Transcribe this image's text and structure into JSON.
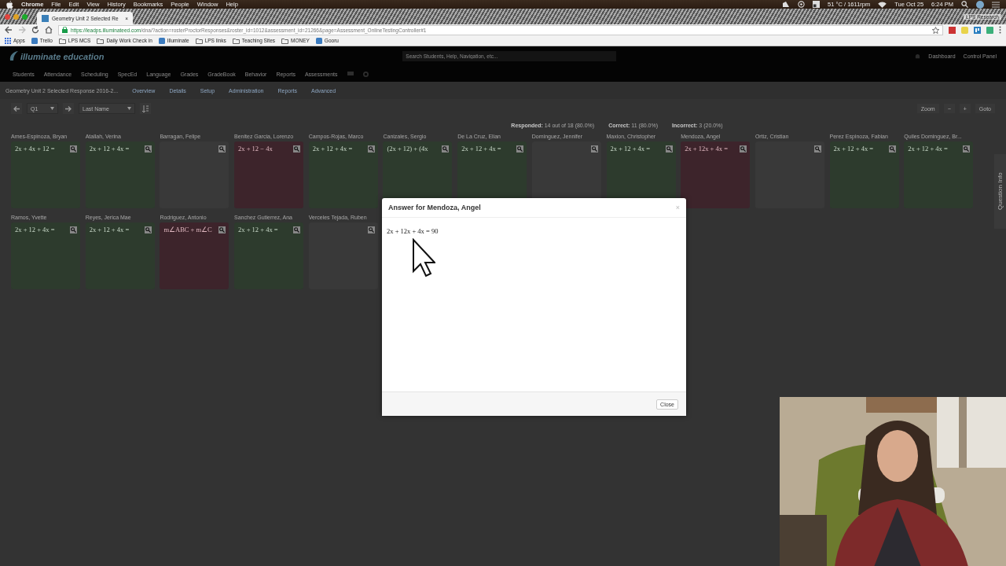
{
  "menubar": {
    "app": "Chrome",
    "menus": [
      "File",
      "Edit",
      "View",
      "History",
      "Bookmarks",
      "People",
      "Window",
      "Help"
    ],
    "sensor": "51 °C / 1611rpm",
    "date": "Tue Oct 25",
    "time": "6:24 PM"
  },
  "browser": {
    "tab_title": "Geometry Unit 2 Selected Re",
    "tab_close": "×",
    "profile": "LPS Research",
    "url_host": "https://leadps.illuminateed.com",
    "url_path": "/dna/?action=rosterProctorResponses&roster_id=1012&assessment_id=21266&page=Assessment_OnlineTestingController#1",
    "bookmarks": [
      {
        "label": "Apps",
        "kind": "apps"
      },
      {
        "label": "Trello",
        "kind": "site"
      },
      {
        "label": "LPS MCS",
        "kind": "folder"
      },
      {
        "label": "Daily Work Check in",
        "kind": "folder"
      },
      {
        "label": "Illuminate",
        "kind": "site"
      },
      {
        "label": "LPS links",
        "kind": "folder"
      },
      {
        "label": "Teaching Sites",
        "kind": "folder"
      },
      {
        "label": "MONEY",
        "kind": "folder"
      },
      {
        "label": "Gooru",
        "kind": "site"
      }
    ]
  },
  "header": {
    "logo": "illuminate education",
    "search": {
      "placeholder": "Search Students, Help, Navigation, etc..."
    },
    "links": [
      "Dashboard",
      "Control Panel"
    ]
  },
  "nav": [
    "Students",
    "Attendance",
    "Scheduling",
    "SpecEd",
    "Language",
    "Grades",
    "GradeBook",
    "Behavior",
    "Reports",
    "Assessments"
  ],
  "subnav": {
    "title": "Geometry Unit 2 Selected Response 2016-2...",
    "links": [
      "Overview",
      "Details",
      "Setup",
      "Administration",
      "Reports",
      "Advanced"
    ]
  },
  "toolbar": {
    "question": "Q1",
    "sort": "Last Name",
    "zoom": "Zoom",
    "zoom_out": "−",
    "zoom_in": "+",
    "goto": "Goto"
  },
  "stats": [
    {
      "label": "Responded:",
      "value": "14 out of 18 (80.0%)"
    },
    {
      "label": "Correct:",
      "value": "11 (80.0%)"
    },
    {
      "label": "Incorrect:",
      "value": "3 (20.0%)"
    }
  ],
  "students": [
    {
      "name": "Ames-Espinoza, Bryan",
      "kind": "correct",
      "answer": "2x + 4x + 12 ="
    },
    {
      "name": "Atallah, Verina",
      "kind": "correct",
      "answer": "2x + 12 + 4x ="
    },
    {
      "name": "Barragan, Felipe",
      "kind": "empty"
    },
    {
      "name": "Benitez Garcia, Lorenzo",
      "kind": "incorrect",
      "answer": "2x + 12 − 4x"
    },
    {
      "name": "Campos-Rojas, Marco",
      "kind": "correct",
      "answer": "2x + 12 + 4x ="
    },
    {
      "name": "Canizales, Sergio",
      "kind": "correct",
      "answer": "(2x + 12) + (4x"
    },
    {
      "name": "De La Cruz, Elian",
      "kind": "correct",
      "answer": "2x + 12 + 4x ="
    },
    {
      "name": "Dominguez, Jennifer",
      "kind": "empty"
    },
    {
      "name": "Maxion, Christopher",
      "kind": "correct",
      "answer": "2x + 12 + 4x ="
    },
    {
      "name": "Mendoza, Angel",
      "kind": "incorrect",
      "answer": "2x + 12x + 4x ="
    },
    {
      "name": "Ortiz, Cristian",
      "kind": "empty"
    },
    {
      "name": "Perez Espinoza, Fabian",
      "kind": "correct",
      "answer": "2x + 12 + 4x ="
    },
    {
      "name": "Quiles Dominguez, Br...",
      "kind": "correct",
      "answer": "2x + 12 + 4x ="
    },
    {
      "name": "Ramos, Yvette",
      "kind": "correct",
      "answer": "2x + 12 + 4x ="
    },
    {
      "name": "Reyes, Jerica Mae",
      "kind": "correct",
      "answer": "2x + 12 + 4x ="
    },
    {
      "name": "Rodriguez, Antonio",
      "kind": "incorrect",
      "answer": "m∠ABC + m∠C"
    },
    {
      "name": "Sanchez Gutierrez, Ana",
      "kind": "correct",
      "answer": "2x + 12 + 4x ="
    },
    {
      "name": "Verceles Tejada, Ruben",
      "kind": "empty"
    }
  ],
  "side_tab": "Question Info",
  "modal": {
    "title": "Answer for Mendoza, Angel",
    "close": "×",
    "answer": "2x + 12x + 4x = 90",
    "button": "Close"
  }
}
